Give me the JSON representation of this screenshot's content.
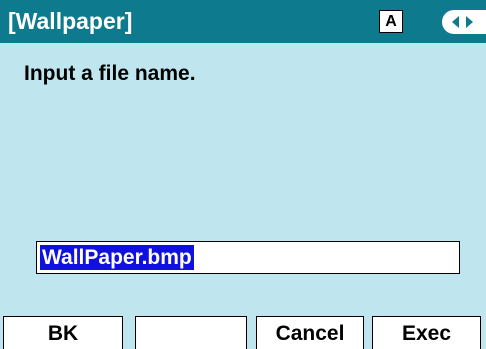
{
  "title_bar": {
    "title": "[Wallpaper]",
    "mode_badge": "A",
    "nav_icon": "left-right-arrows-icon"
  },
  "main": {
    "prompt": "Input a file name.",
    "file_name_input": {
      "value": "WallPaper.bmp",
      "selected": true
    }
  },
  "softkeys": [
    {
      "label": "BK"
    },
    {
      "label": ""
    },
    {
      "label": "Cancel"
    },
    {
      "label": "Exec"
    }
  ],
  "colors": {
    "title_bar_bg": "#0e7a8e",
    "screen_bg": "#bfe6ee",
    "selection_bg": "#1111dd"
  }
}
